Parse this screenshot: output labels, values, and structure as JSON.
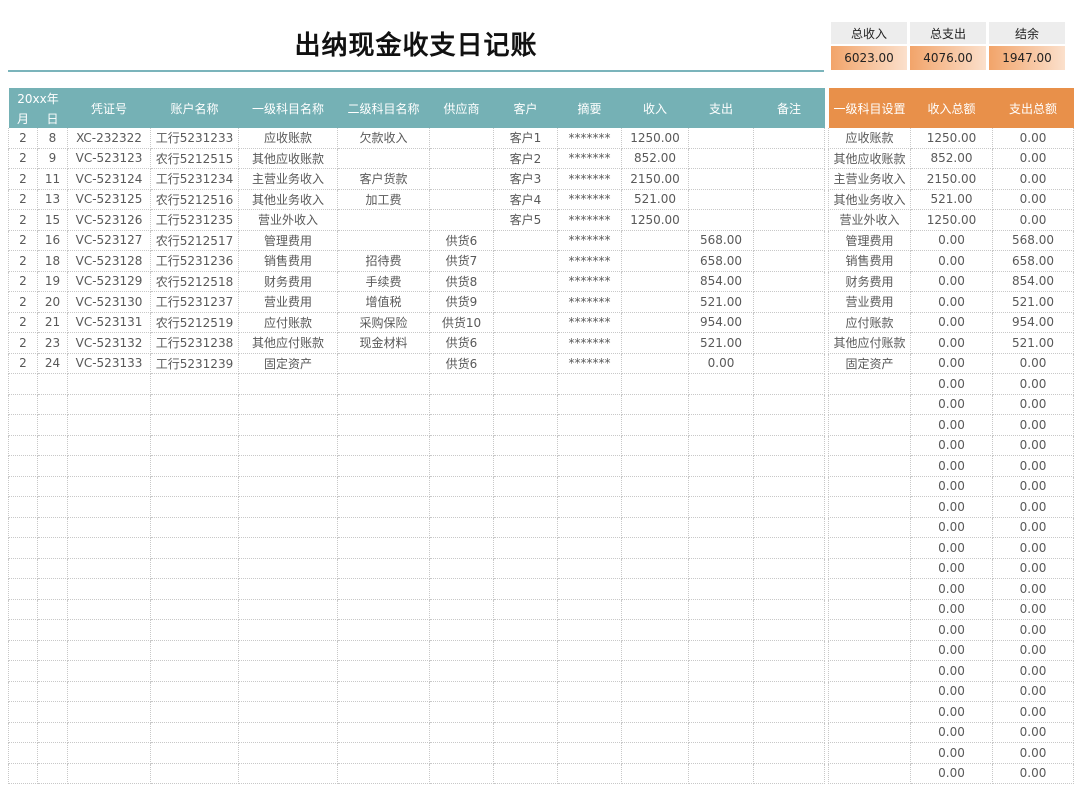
{
  "title": "出纳现金收支日记账",
  "summary": {
    "headers": [
      "总收入",
      "总支出",
      "结余"
    ],
    "values": [
      "6023.00",
      "4076.00",
      "1947.00"
    ]
  },
  "ledger": {
    "year_label": "20xx年",
    "month_label": "月",
    "day_label": "日",
    "headers": [
      "凭证号",
      "账户名称",
      "一级科目名称",
      "二级科目名称",
      "供应商",
      "客户",
      "摘要",
      "收入",
      "支出",
      "备注"
    ],
    "rows": [
      [
        "2",
        "8",
        "XC-232322",
        "工行5231233",
        "应收账款",
        "欠款收入",
        "",
        "客户1",
        "*******",
        "1250.00",
        "",
        ""
      ],
      [
        "2",
        "9",
        "VC-523123",
        "农行5212515",
        "其他应收账款",
        "",
        "",
        "客户2",
        "*******",
        "852.00",
        "",
        ""
      ],
      [
        "2",
        "11",
        "VC-523124",
        "工行5231234",
        "主营业务收入",
        "客户货款",
        "",
        "客户3",
        "*******",
        "2150.00",
        "",
        ""
      ],
      [
        "2",
        "13",
        "VC-523125",
        "农行5212516",
        "其他业务收入",
        "加工费",
        "",
        "客户4",
        "*******",
        "521.00",
        "",
        ""
      ],
      [
        "2",
        "15",
        "VC-523126",
        "工行5231235",
        "营业外收入",
        "",
        "",
        "客户5",
        "*******",
        "1250.00",
        "",
        ""
      ],
      [
        "2",
        "16",
        "VC-523127",
        "农行5212517",
        "管理费用",
        "",
        "供货6",
        "",
        "*******",
        "",
        "568.00",
        ""
      ],
      [
        "2",
        "18",
        "VC-523128",
        "工行5231236",
        "销售费用",
        "招待费",
        "供货7",
        "",
        "*******",
        "",
        "658.00",
        ""
      ],
      [
        "2",
        "19",
        "VC-523129",
        "农行5212518",
        "财务费用",
        "手续费",
        "供货8",
        "",
        "*******",
        "",
        "854.00",
        ""
      ],
      [
        "2",
        "20",
        "VC-523130",
        "工行5231237",
        "营业费用",
        "增值税",
        "供货9",
        "",
        "*******",
        "",
        "521.00",
        ""
      ],
      [
        "2",
        "21",
        "VC-523131",
        "农行5212519",
        "应付账款",
        "采购保险",
        "供货10",
        "",
        "*******",
        "",
        "954.00",
        ""
      ],
      [
        "2",
        "23",
        "VC-523132",
        "工行5231238",
        "其他应付账款",
        "现金材料",
        "供货6",
        "",
        "*******",
        "",
        "521.00",
        ""
      ],
      [
        "2",
        "24",
        "VC-523133",
        "工行5231239",
        "固定资产",
        "",
        "供货6",
        "",
        "*******",
        "",
        "0.00",
        ""
      ]
    ],
    "empty_row_count": 20
  },
  "subjects": {
    "headers": [
      "一级科目设置",
      "收入总额",
      "支出总额"
    ],
    "rows": [
      [
        "应收账款",
        "1250.00",
        "0.00"
      ],
      [
        "其他应收账款",
        "852.00",
        "0.00"
      ],
      [
        "主营业务收入",
        "2150.00",
        "0.00"
      ],
      [
        "其他业务收入",
        "521.00",
        "0.00"
      ],
      [
        "营业外收入",
        "1250.00",
        "0.00"
      ],
      [
        "管理费用",
        "0.00",
        "568.00"
      ],
      [
        "销售费用",
        "0.00",
        "658.00"
      ],
      [
        "财务费用",
        "0.00",
        "854.00"
      ],
      [
        "营业费用",
        "0.00",
        "521.00"
      ],
      [
        "应付账款",
        "0.00",
        "954.00"
      ],
      [
        "其他应付账款",
        "0.00",
        "521.00"
      ],
      [
        "固定资产",
        "0.00",
        "0.00"
      ],
      [
        "",
        "0.00",
        "0.00"
      ],
      [
        "",
        "0.00",
        "0.00"
      ],
      [
        "",
        "0.00",
        "0.00"
      ],
      [
        "",
        "0.00",
        "0.00"
      ],
      [
        "",
        "0.00",
        "0.00"
      ],
      [
        "",
        "0.00",
        "0.00"
      ],
      [
        "",
        "0.00",
        "0.00"
      ],
      [
        "",
        "0.00",
        "0.00"
      ],
      [
        "",
        "0.00",
        "0.00"
      ],
      [
        "",
        "0.00",
        "0.00"
      ],
      [
        "",
        "0.00",
        "0.00"
      ],
      [
        "",
        "0.00",
        "0.00"
      ],
      [
        "",
        "0.00",
        "0.00"
      ],
      [
        "",
        "0.00",
        "0.00"
      ],
      [
        "",
        "0.00",
        "0.00"
      ],
      [
        "",
        "0.00",
        "0.00"
      ],
      [
        "",
        "0.00",
        "0.00"
      ],
      [
        "",
        "0.00",
        "0.00"
      ],
      [
        "",
        "0.00",
        "0.00"
      ],
      [
        "",
        "0.00",
        "0.00"
      ]
    ]
  },
  "colors": {
    "ledger_header": "#75b1b5",
    "subject_header": "#e8904a",
    "summary_value": "#f2a46a"
  }
}
